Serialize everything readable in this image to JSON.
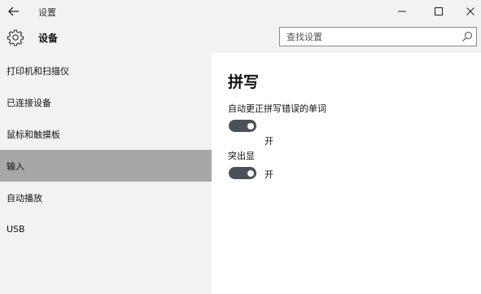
{
  "window": {
    "title": "设置"
  },
  "header": {
    "title": "设备",
    "search_placeholder": "查找设置"
  },
  "sidebar": {
    "items": [
      {
        "label": "打印机和扫描仪"
      },
      {
        "label": "已连接设备"
      },
      {
        "label": "鼠标和触摸板"
      },
      {
        "label": "输入",
        "selected": true
      },
      {
        "label": "自动播放"
      },
      {
        "label": "USB"
      }
    ]
  },
  "content": {
    "title": "拼写",
    "settings": [
      {
        "label": "自动更正拼写错误的单词",
        "state": "开",
        "on": true
      },
      {
        "label": "突出显",
        "state": "开",
        "on": true
      }
    ]
  },
  "colors": {
    "chrome": "#f2f2f2",
    "selected": "#a7a7a7",
    "toggle_on": "#4a5158"
  },
  "icons": [
    "back-arrow-icon",
    "minimize-icon",
    "maximize-icon",
    "close-icon",
    "gear-icon",
    "search-icon"
  ]
}
